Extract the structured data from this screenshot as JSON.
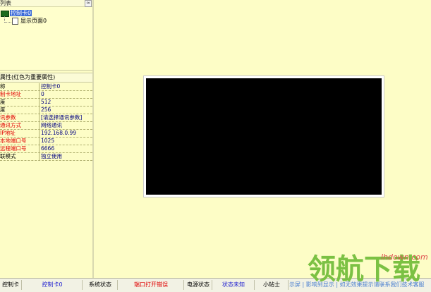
{
  "tree": {
    "header": "列表",
    "collapse_glyph": "≈",
    "nodes": [
      {
        "label": "控制卡0"
      },
      {
        "label": "显示页面0"
      }
    ]
  },
  "properties": {
    "header": "属性(红色为重要属性)",
    "rows": [
      {
        "key": "称",
        "value": "控制卡0"
      },
      {
        "key": "制卡地址",
        "value": "0"
      },
      {
        "key": "度",
        "value": "512"
      },
      {
        "key": "度",
        "value": "256"
      },
      {
        "key": "讯参数",
        "value": "[请选择通讯参数]"
      },
      {
        "key": "通讯方式",
        "value": "网络通讯"
      },
      {
        "key": "IP地址",
        "value": "192.168.0.99"
      },
      {
        "key": "本地端口号",
        "value": "1025"
      },
      {
        "key": "远程端口号",
        "value": "6666"
      },
      {
        "key": "联模式",
        "value": "独立使用"
      }
    ]
  },
  "statusbar": {
    "cells": [
      {
        "text": "控制卡"
      },
      {
        "text": "控制卡0"
      },
      {
        "text": "系统状态"
      },
      {
        "text": "端口打开错误"
      },
      {
        "text": "电源状态"
      },
      {
        "text": "状态未知"
      },
      {
        "text": "小帖士"
      },
      {
        "text": "示屏 | 影响到显示 | 如无效果提示请联系我们技术客服"
      }
    ]
  },
  "watermark": {
    "big": "领航下载",
    "small": "lhdown.com"
  },
  "colors": {
    "background": "#fdfdc6",
    "important_property": "#e00000",
    "selected_node": "#3c6cd8",
    "preview_screen": "#000000"
  }
}
